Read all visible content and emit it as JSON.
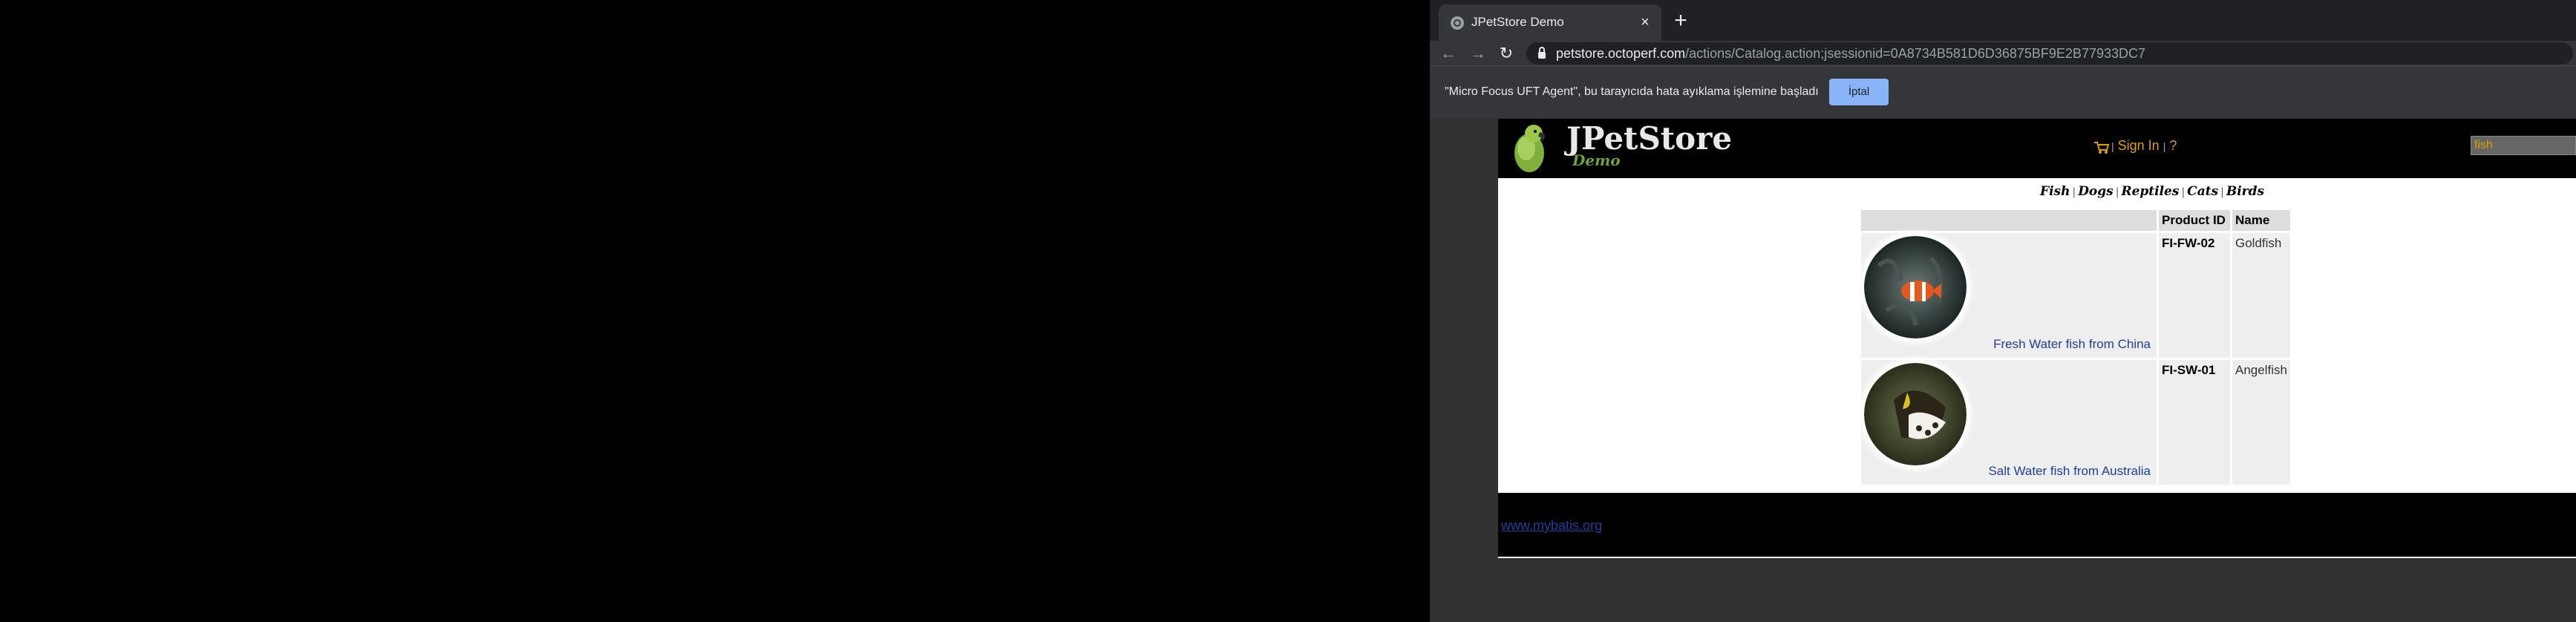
{
  "browser": {
    "tab_title": "JPetStore Demo",
    "tab_close_icon": "close-icon",
    "new_tab_label": "+",
    "url_host": "petstore.octoperf.com",
    "url_path": "/actions/Catalog.action;jsessionid=0A8734B581D6D36875BF9E2B77933DC7",
    "infobar_text": "\"Micro Focus UFT Agent\", bu tarayıcıda hata ayıklama işlemine başladı",
    "infobar_button": "İptal"
  },
  "site": {
    "logo_text": "JPetStore",
    "logo_demo": "Demo",
    "sign_in": "Sign In",
    "help": "?",
    "search_value": "fish",
    "categories": [
      "Fish",
      "Dogs",
      "Reptiles",
      "Cats",
      "Birds"
    ],
    "table": {
      "headers": [
        "",
        "Product ID",
        "Name"
      ],
      "rows": [
        {
          "description": "Fresh Water fish from China",
          "product_id": "FI-FW-02",
          "name": "Goldfish"
        },
        {
          "description": "Salt Water fish from Australia",
          "product_id": "FI-SW-01",
          "name": "Angelfish"
        }
      ]
    },
    "footer_link": "www.mybatis.org"
  },
  "colors": {
    "accent_link": "#1f3f99",
    "header_link": "#e0a000",
    "infobar_button": "#8ab4f8"
  }
}
